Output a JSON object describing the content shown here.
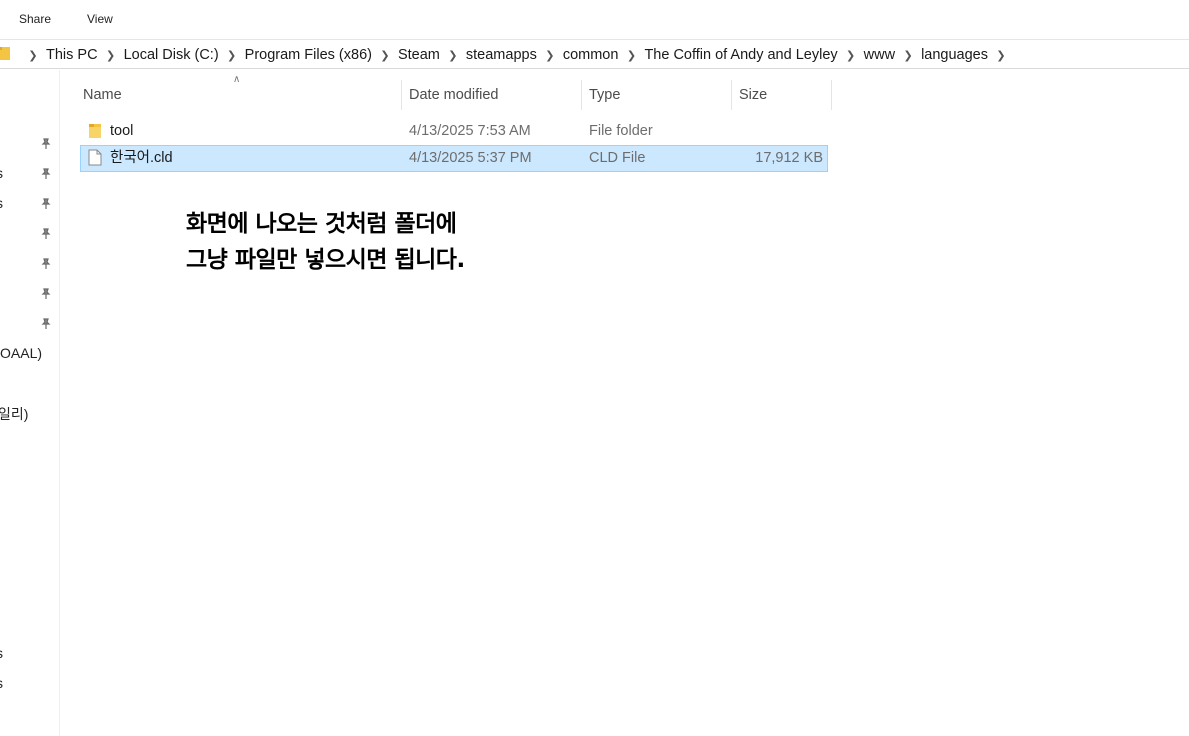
{
  "ribbon": {
    "tabs": [
      "Share",
      "View"
    ]
  },
  "address": {
    "crumbs": [
      "This PC",
      "Local Disk (C:)",
      "Program Files (x86)",
      "Steam",
      "steamapps",
      "common",
      "The Coffin of Andy and Leyley",
      "www",
      "languages"
    ]
  },
  "nav": {
    "fragments": [
      "s",
      "s",
      "OAAL)",
      "일리)",
      "s",
      "s"
    ]
  },
  "columns": {
    "name": "Name",
    "date": "Date modified",
    "type": "Type",
    "size": "Size"
  },
  "files": [
    {
      "name": "tool",
      "date": "4/13/2025 7:53 AM",
      "type": "File folder",
      "size": "",
      "icon": "folder-icon"
    },
    {
      "name": "한국어.cld",
      "date": "4/13/2025 5:37 PM",
      "type": "CLD File",
      "size": "17,912 KB",
      "icon": "file-icon",
      "selected": true
    }
  ],
  "annotation": {
    "line1": "화면에 나오는 것처럼 폴더에",
    "line2": "그냥 파일만 넣으시면 됩니다."
  },
  "colors": {
    "selection": "#cce8ff",
    "selection_border": "#99d1ff",
    "folder": "#f4c542"
  }
}
